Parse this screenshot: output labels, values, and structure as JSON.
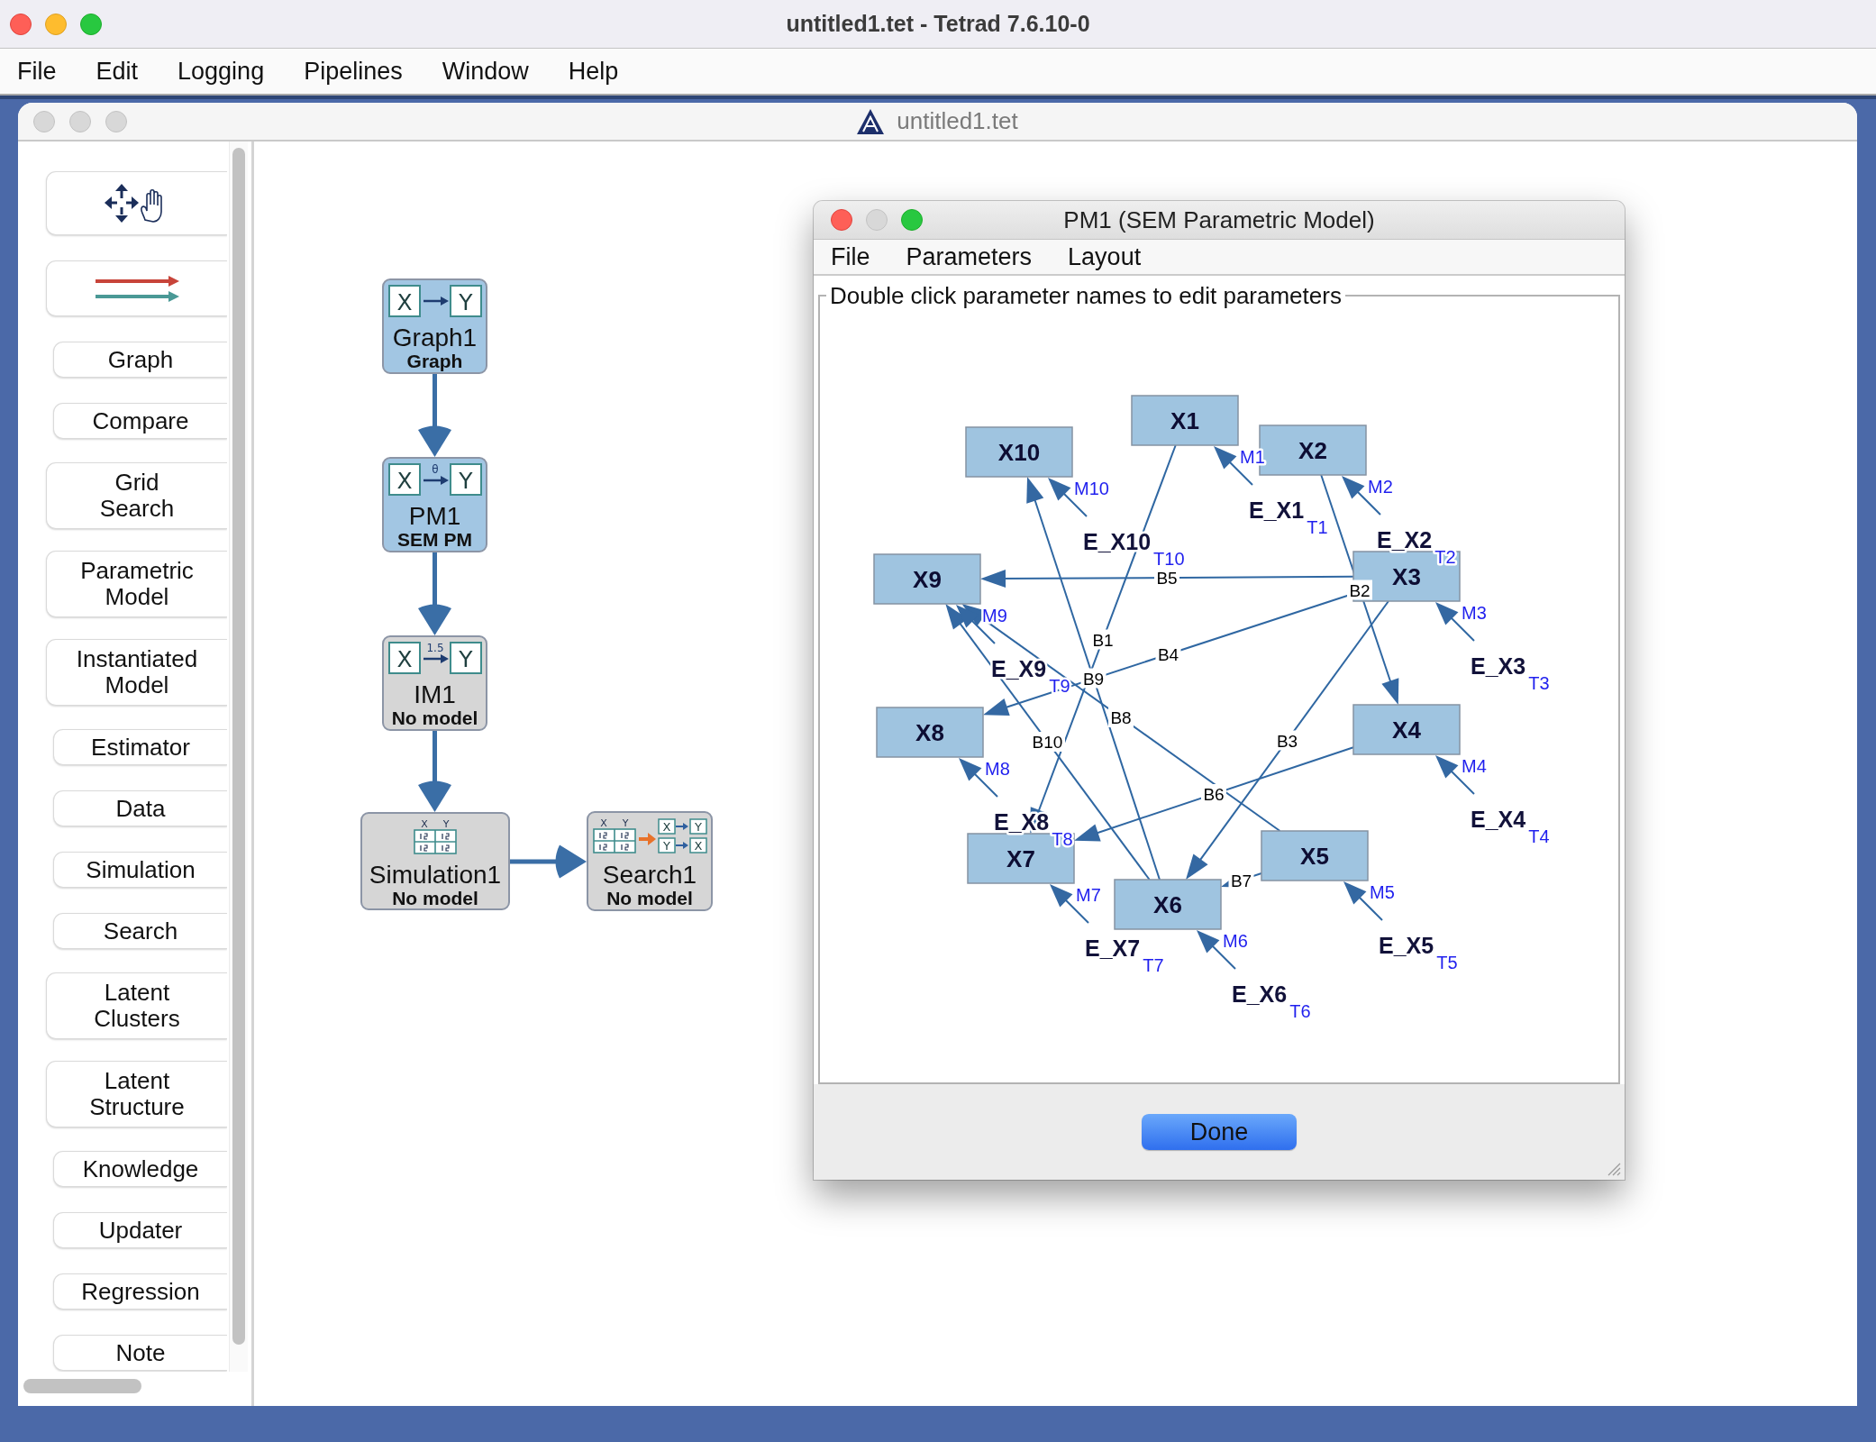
{
  "window": {
    "title": "untitled1.tet - Tetrad 7.6.10-0",
    "active": true
  },
  "menu_bar": [
    "File",
    "Edit",
    "Logging",
    "Pipelines",
    "Window",
    "Help"
  ],
  "session": {
    "title": "untitled1.tet",
    "active": false,
    "toolbox": [
      {
        "kind": "move"
      },
      {
        "kind": "flow"
      },
      {
        "kind": "text",
        "label": "Graph"
      },
      {
        "kind": "text",
        "label": "Compare"
      },
      {
        "kind": "text",
        "label": "Grid\nSearch"
      },
      {
        "kind": "text",
        "label": "Parametric\nModel"
      },
      {
        "kind": "text",
        "label": "Instantiated\nModel"
      },
      {
        "kind": "text",
        "label": "Estimator"
      },
      {
        "kind": "text",
        "label": "Data"
      },
      {
        "kind": "text",
        "label": "Simulation"
      },
      {
        "kind": "text",
        "label": "Search"
      },
      {
        "kind": "text",
        "label": "Latent\nClusters"
      },
      {
        "kind": "text",
        "label": "Latent\nStructure"
      },
      {
        "kind": "text",
        "label": "Knowledge"
      },
      {
        "kind": "text",
        "label": "Updater"
      },
      {
        "kind": "text",
        "label": "Regression"
      },
      {
        "kind": "text",
        "label": "Note"
      }
    ],
    "workflow": [
      {
        "name": "Graph1",
        "type": "Graph",
        "has_model": true,
        "icon": {
          "kind": "graph",
          "labels": [
            "X",
            "Y"
          ]
        }
      },
      {
        "name": "PM1",
        "type": "SEM PM",
        "has_model": true,
        "icon": {
          "kind": "labeled_arrow",
          "labels": [
            "X",
            "Y"
          ],
          "over_arrow": "θ"
        }
      },
      {
        "name": "IM1",
        "type": "No model",
        "has_model": false,
        "icon": {
          "kind": "labeled_arrow",
          "labels": [
            "X",
            "Y"
          ],
          "over_arrow": "1.5"
        }
      },
      {
        "name": "Simulation1",
        "type": "No model",
        "has_model": false,
        "icon": {
          "kind": "data",
          "labels": [
            "X",
            "Y"
          ]
        }
      },
      {
        "name": "Search1",
        "type": "No model",
        "has_model": false,
        "icon": {
          "kind": "search",
          "labels": [
            "X",
            "Y",
            "X",
            "Y",
            "Y",
            "X"
          ]
        }
      }
    ]
  },
  "dialog": {
    "title": "PM1 (SEM Parametric Model)",
    "minimize_enabled": false,
    "menu": [
      "File",
      "Parameters",
      "Layout"
    ],
    "panel_title": "Double click parameter names to edit parameters",
    "graph": {
      "nodes": [
        {
          "name": "X10",
          "error_term": "E_X10",
          "error_variance_label": "T10",
          "error_edge_label": "M10"
        },
        {
          "name": "X1",
          "error_term": "E_X1",
          "error_variance_label": "T1",
          "error_edge_label": "M1"
        },
        {
          "name": "X2",
          "error_term": "E_X2",
          "error_variance_label": "T2",
          "error_edge_label": "M2"
        },
        {
          "name": "X9",
          "error_term": "E_X9",
          "error_variance_label": "T9",
          "error_edge_label": "M9"
        },
        {
          "name": "X3",
          "error_term": "E_X3",
          "error_variance_label": "T3",
          "error_edge_label": "M3"
        },
        {
          "name": "X8",
          "error_term": "E_X8",
          "error_variance_label": "T8",
          "error_edge_label": "M8"
        },
        {
          "name": "X4",
          "error_term": "E_X4",
          "error_variance_label": "T4",
          "error_edge_label": "M4"
        },
        {
          "name": "X7",
          "error_term": "E_X7",
          "error_variance_label": "T7",
          "error_edge_label": "M7"
        },
        {
          "name": "X6",
          "error_term": "E_X6",
          "error_variance_label": "T6",
          "error_edge_label": "M6"
        },
        {
          "name": "X5",
          "error_term": "E_X5",
          "error_variance_label": "T5",
          "error_edge_label": "M5"
        }
      ],
      "edges": [
        {
          "label": "B5"
        },
        {
          "label": "B2"
        },
        {
          "label": "B1"
        },
        {
          "label": "B4"
        },
        {
          "label": "B9"
        },
        {
          "label": "B8"
        },
        {
          "label": "B10"
        },
        {
          "label": "B3"
        },
        {
          "label": "B6"
        },
        {
          "label": "B7"
        }
      ]
    },
    "button": "Done"
  }
}
